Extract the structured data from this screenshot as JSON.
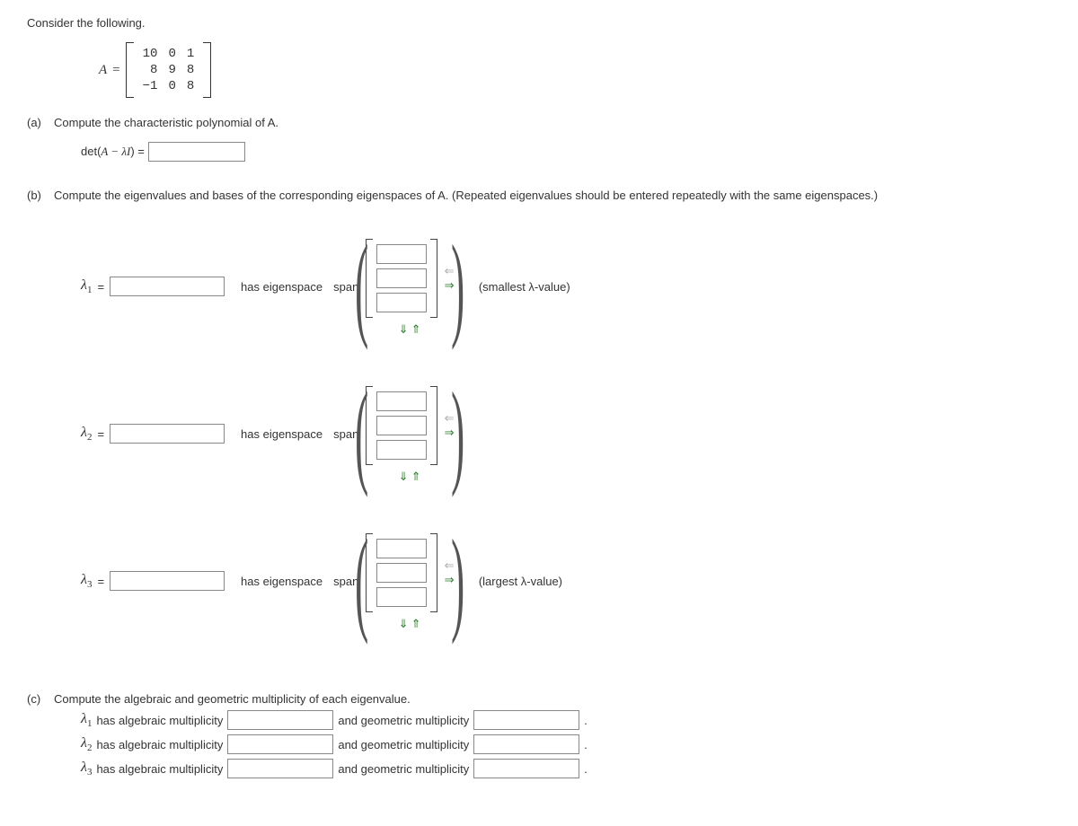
{
  "intro": "Consider the following.",
  "matrix_var": "A",
  "matrix_rows": [
    [
      "10",
      "0",
      "1"
    ],
    [
      "8",
      "9",
      "8"
    ],
    [
      "−1",
      "0",
      "8"
    ]
  ],
  "parts": {
    "a": {
      "label": "(a)",
      "text": "Compute the characteristic polynomial of A.",
      "det_label_pre": "det(",
      "det_label_mid": "A − λI",
      "det_label_post": ") ="
    },
    "b": {
      "label": "(b)",
      "text": "Compute the eigenvalues and bases of the corresponding eigenspaces of A. (Repeated eigenvalues should be entered repeatedly with the same eigenspaces.)",
      "rows": [
        {
          "lambda": "λ",
          "sub": "1",
          "has": "has eigenspace",
          "span": "span",
          "note": "(smallest λ-value)"
        },
        {
          "lambda": "λ",
          "sub": "2",
          "has": "has eigenspace",
          "span": "span",
          "note": ""
        },
        {
          "lambda": "λ",
          "sub": "3",
          "has": "has eigenspace",
          "span": "span",
          "note": "(largest λ-value)"
        }
      ]
    },
    "c": {
      "label": "(c)",
      "text": "Compute the algebraic and geometric multiplicity of each eigenvalue.",
      "lines": [
        {
          "pre": "λ",
          "sub": "1",
          "t1": " has algebraic multiplicity ",
          "t2": " and geometric multiplicity ",
          "end": "."
        },
        {
          "pre": "λ",
          "sub": "2",
          "t1": " has algebraic multiplicity ",
          "t2": " and geometric multiplicity ",
          "end": "."
        },
        {
          "pre": "λ",
          "sub": "3",
          "t1": " has algebraic multiplicity ",
          "t2": " and geometric multiplicity ",
          "end": "."
        }
      ]
    }
  },
  "arrows": {
    "left_dim": "⇐",
    "right": "⇒",
    "down": "⇓",
    "up": "⇑"
  }
}
